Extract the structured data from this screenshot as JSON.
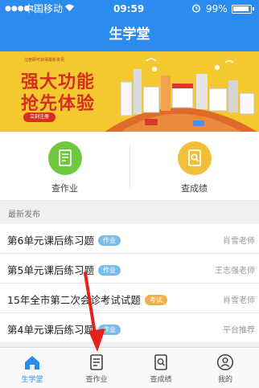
{
  "status_bar": {
    "carrier": "中国移动",
    "time": "09:59",
    "battery": "99%"
  },
  "header": {
    "title": "生学堂"
  },
  "banner": {
    "small_text": "注册即可获得最新资讯",
    "line1": "强大功能",
    "line2": "抢先体验",
    "button_label": "立刻注册"
  },
  "quick_actions": [
    {
      "label": "查作业",
      "icon": "homework-icon",
      "color": "#6fc83d"
    },
    {
      "label": "查成绩",
      "icon": "grade-search-icon",
      "color": "#f2bf3a"
    }
  ],
  "list": {
    "section_title": "最新发布",
    "items": [
      {
        "title": "第6单元课后练习题",
        "tag": "作业",
        "author": "肖雪老师"
      },
      {
        "title": "第5单元课后练习题",
        "tag": "作业",
        "author": "王志强老师"
      },
      {
        "title": "15年全市第二次会诊考试试题",
        "tag": "考试",
        "author": "肖雪老师"
      },
      {
        "title": "第4单元课后练习题",
        "tag": "作业",
        "author": "平台推荐"
      }
    ]
  },
  "tab_bar": {
    "tabs": [
      {
        "label": "生学堂",
        "icon": "home-icon",
        "active": true
      },
      {
        "label": "查作业",
        "icon": "homework-icon",
        "active": false
      },
      {
        "label": "查成绩",
        "icon": "grade-search-icon",
        "active": false
      },
      {
        "label": "我的",
        "icon": "profile-icon",
        "active": false
      }
    ]
  },
  "colors": {
    "primary": "#2b8bef",
    "banner": "#f3c92f",
    "tag_homework": "#7bbde8",
    "tag_exam": "#f1b04a",
    "annotation_arrow": "#e3241b"
  }
}
